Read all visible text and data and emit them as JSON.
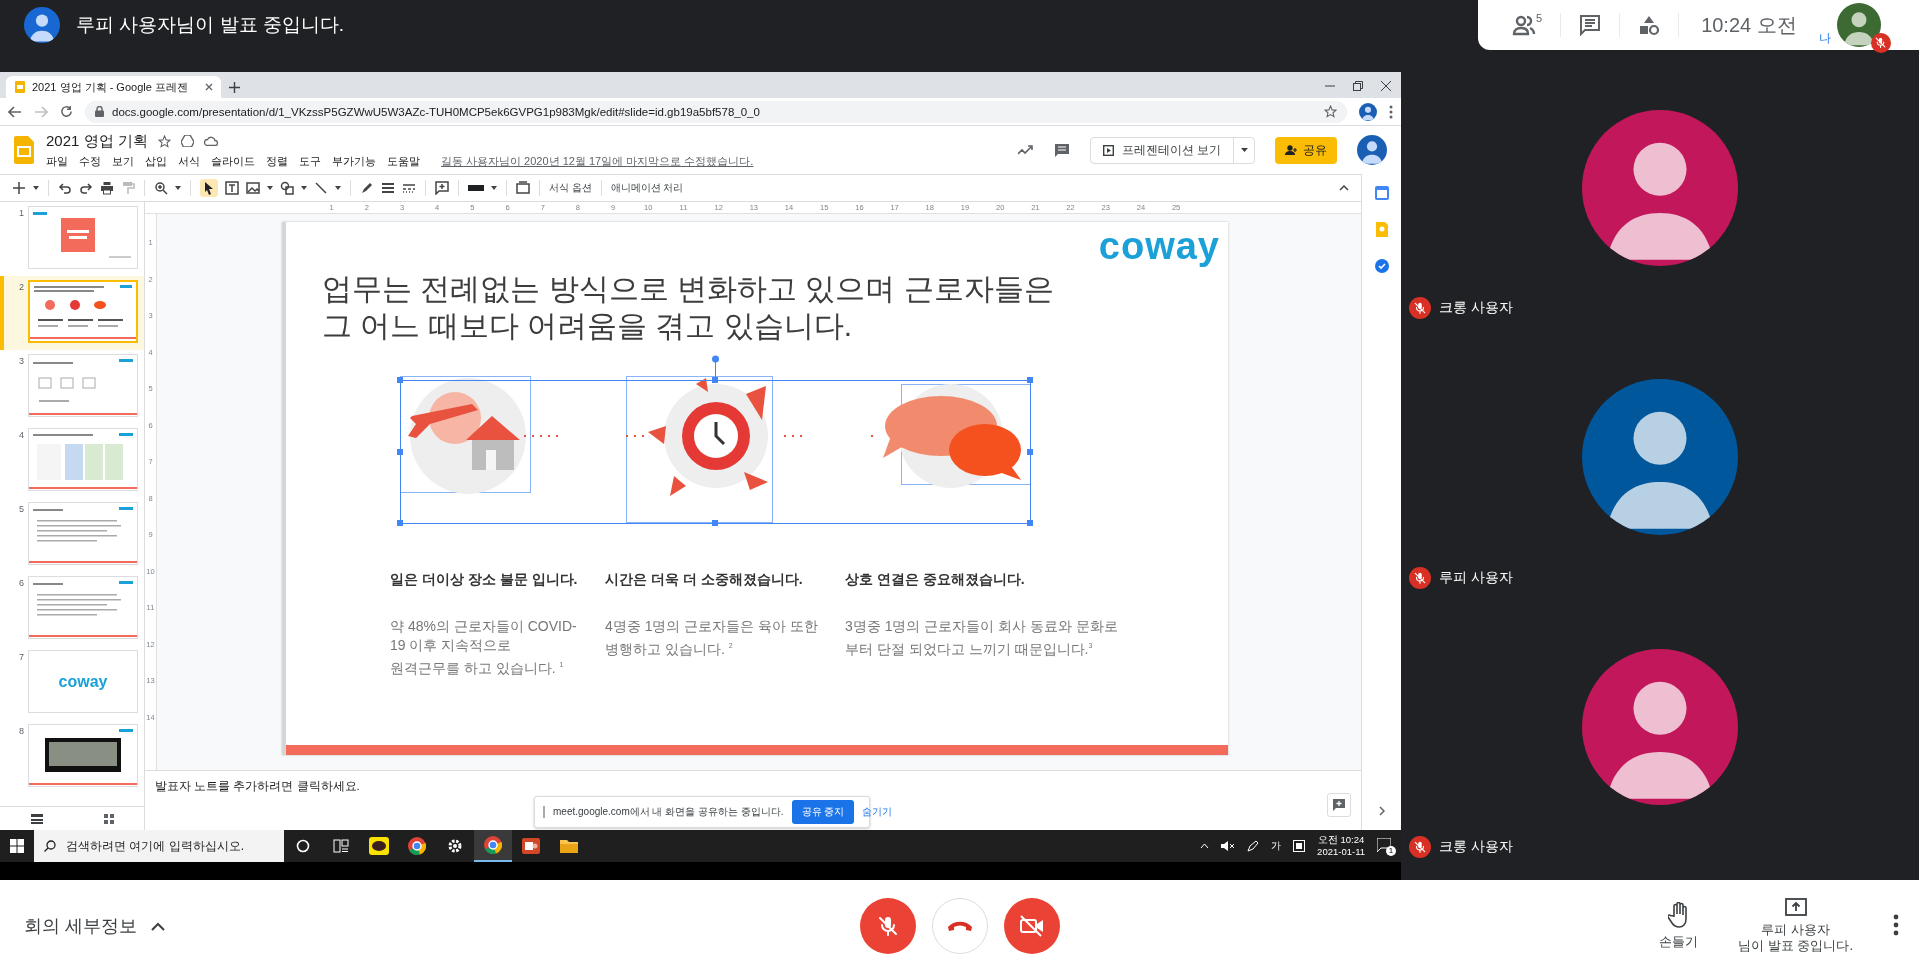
{
  "presenter_bar": {
    "message": "루피 사용자님이 발표 중입니다."
  },
  "top_controls": {
    "participant_count": "5",
    "time": "10:24 오전",
    "self_label": "나",
    "self_muted": true
  },
  "browser": {
    "tab_title": "2021 영업 기획 - Google 프레젠",
    "url": "docs.google.com/presentation/d/1_VKzssP5GZWwU5W3AZc-TUH0MCP5ek6GVPG1p983Mgk/edit#slide=id.gb19a5bf578_0_0"
  },
  "docs": {
    "title": "2021 영업 기획",
    "menus": [
      "파일",
      "수정",
      "보기",
      "삽입",
      "서식",
      "슬라이드",
      "정렬",
      "도구",
      "부가기능",
      "도움말"
    ],
    "last_edit": "길동 사용자님이 2020년 12월 17일에 마지막으로 수정했습니다.",
    "present_button": "프레젠테이션 보기",
    "share_button": "공유"
  },
  "toolbar": {
    "select_tool_active": true,
    "format_options": "서식 옵션",
    "animation": "애니메이션 처리"
  },
  "rulers": {
    "horizontal": [
      "1",
      "2",
      "3",
      "4",
      "5",
      "6",
      "7",
      "8",
      "9",
      "10",
      "11",
      "12",
      "13",
      "14",
      "15",
      "16",
      "17",
      "18",
      "19",
      "20",
      "21",
      "22",
      "23",
      "24",
      "25"
    ],
    "vertical": [
      "1",
      "2",
      "3",
      "4",
      "5",
      "6",
      "7",
      "8",
      "9",
      "10",
      "11",
      "12",
      "13",
      "14"
    ]
  },
  "thumbnails": [
    {
      "number": "1",
      "kind": "title",
      "selected": false
    },
    {
      "number": "2",
      "kind": "icons",
      "selected": true
    },
    {
      "number": "3",
      "kind": "boxes",
      "selected": false
    },
    {
      "number": "4",
      "kind": "table",
      "selected": false
    },
    {
      "number": "5",
      "kind": "text",
      "selected": false
    },
    {
      "number": "6",
      "kind": "text",
      "selected": false
    },
    {
      "number": "7",
      "kind": "logo",
      "logo": "coway",
      "selected": false
    },
    {
      "number": "8",
      "kind": "photo",
      "selected": false
    }
  ],
  "slide": {
    "logo": "coway",
    "title": "업무는 전례없는 방식으로 변화하고 있으며 근로자들은 그 어느 때보다 어려움을 겪고 있습니다.",
    "columns": [
      {
        "heading": "일은 더이상 장소 불문 입니다.",
        "body": "약 48%의 근로자들이 COVID-19 이후 지속적으로 원격근무를 하고 있습니다. $^{1}$"
      },
      {
        "heading": "시간은 더욱 더 소중해졌습니다.",
        "body": "4명중 1명의 근로자들은 육아 또한 병행하고 있습니다. $^{2}$"
      },
      {
        "heading": "상호 연결은 중요해졌습니다.",
        "body": "3명중 1명의 근로자들이 회사 동료와 문화로 부터 단절 되었다고 느끼기 때문입니다.$^{3}$"
      }
    ]
  },
  "speaker_notes": {
    "prompt": "발표자 노트를 추가하려면 클릭하세요."
  },
  "share_banner": {
    "message": "meet.google.com에서 내 화면을 공유하는 중입니다.",
    "stop_button": "공유 중지",
    "hide_link": "숨기기"
  },
  "taskbar": {
    "search_placeholder": "검색하려면 여기에 입력하십시오.",
    "ime": "가",
    "time": "오전 10:24",
    "date": "2021-01-11",
    "notification_count": "1"
  },
  "participants": [
    {
      "name": "크롱 사용자",
      "color": "#c2185b",
      "muted": true
    },
    {
      "name": "루피 사용자",
      "color": "#01579b",
      "muted": true
    },
    {
      "name": "크롱 사용자",
      "color": "#c2185b",
      "muted": true
    }
  ],
  "bottom_bar": {
    "meeting_details": "회의 세부정보",
    "mic_on": false,
    "camera_on": false,
    "raise_hand": "손들기",
    "presenting_lines": [
      "루피 사용자",
      "님이 발표 중입니다."
    ]
  }
}
